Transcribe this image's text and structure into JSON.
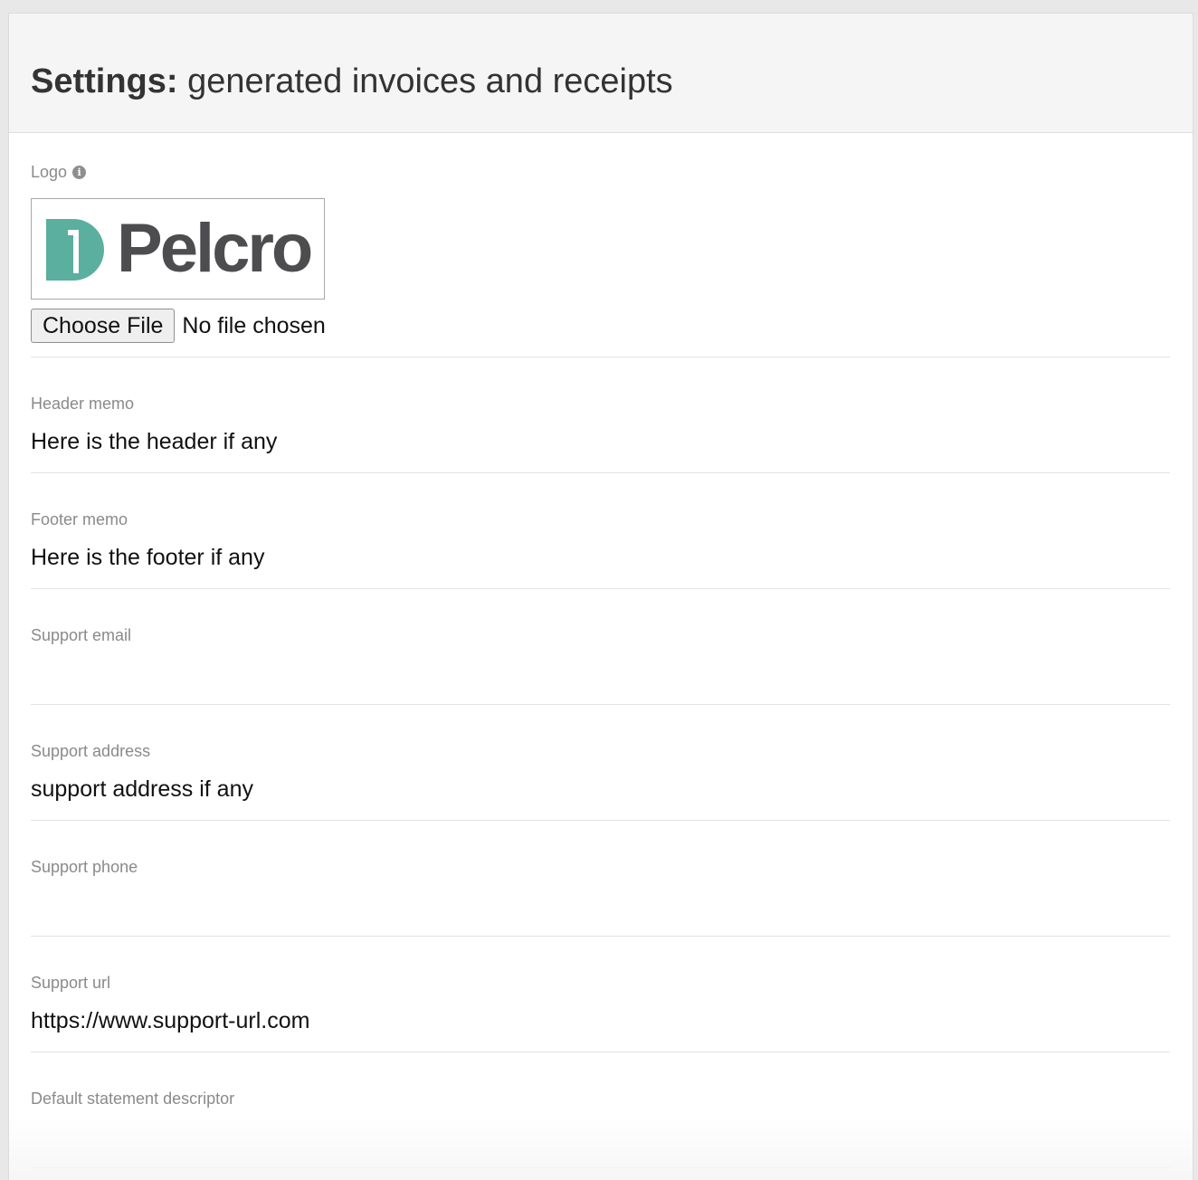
{
  "header": {
    "title_bold": "Settings:",
    "title_rest": " generated invoices and receipts"
  },
  "logo": {
    "label": "Logo",
    "info_icon": "info-circle-icon",
    "brand_text": "Pelcro",
    "brand_color": "#5aaf9f",
    "choose_file_label": "Choose File",
    "file_status": "No file chosen"
  },
  "fields": {
    "header_memo": {
      "label": "Header memo",
      "value": "Here is the header if any"
    },
    "footer_memo": {
      "label": "Footer memo",
      "value": "Here is the footer if any"
    },
    "support_email": {
      "label": "Support email",
      "value": ""
    },
    "support_address": {
      "label": "Support address",
      "value": "support address if any"
    },
    "support_phone": {
      "label": "Support phone",
      "value": ""
    },
    "support_url": {
      "label": "Support url",
      "value": "https://www.support-url.com"
    },
    "statement_descriptor": {
      "label": "Default statement descriptor",
      "value": ""
    }
  }
}
